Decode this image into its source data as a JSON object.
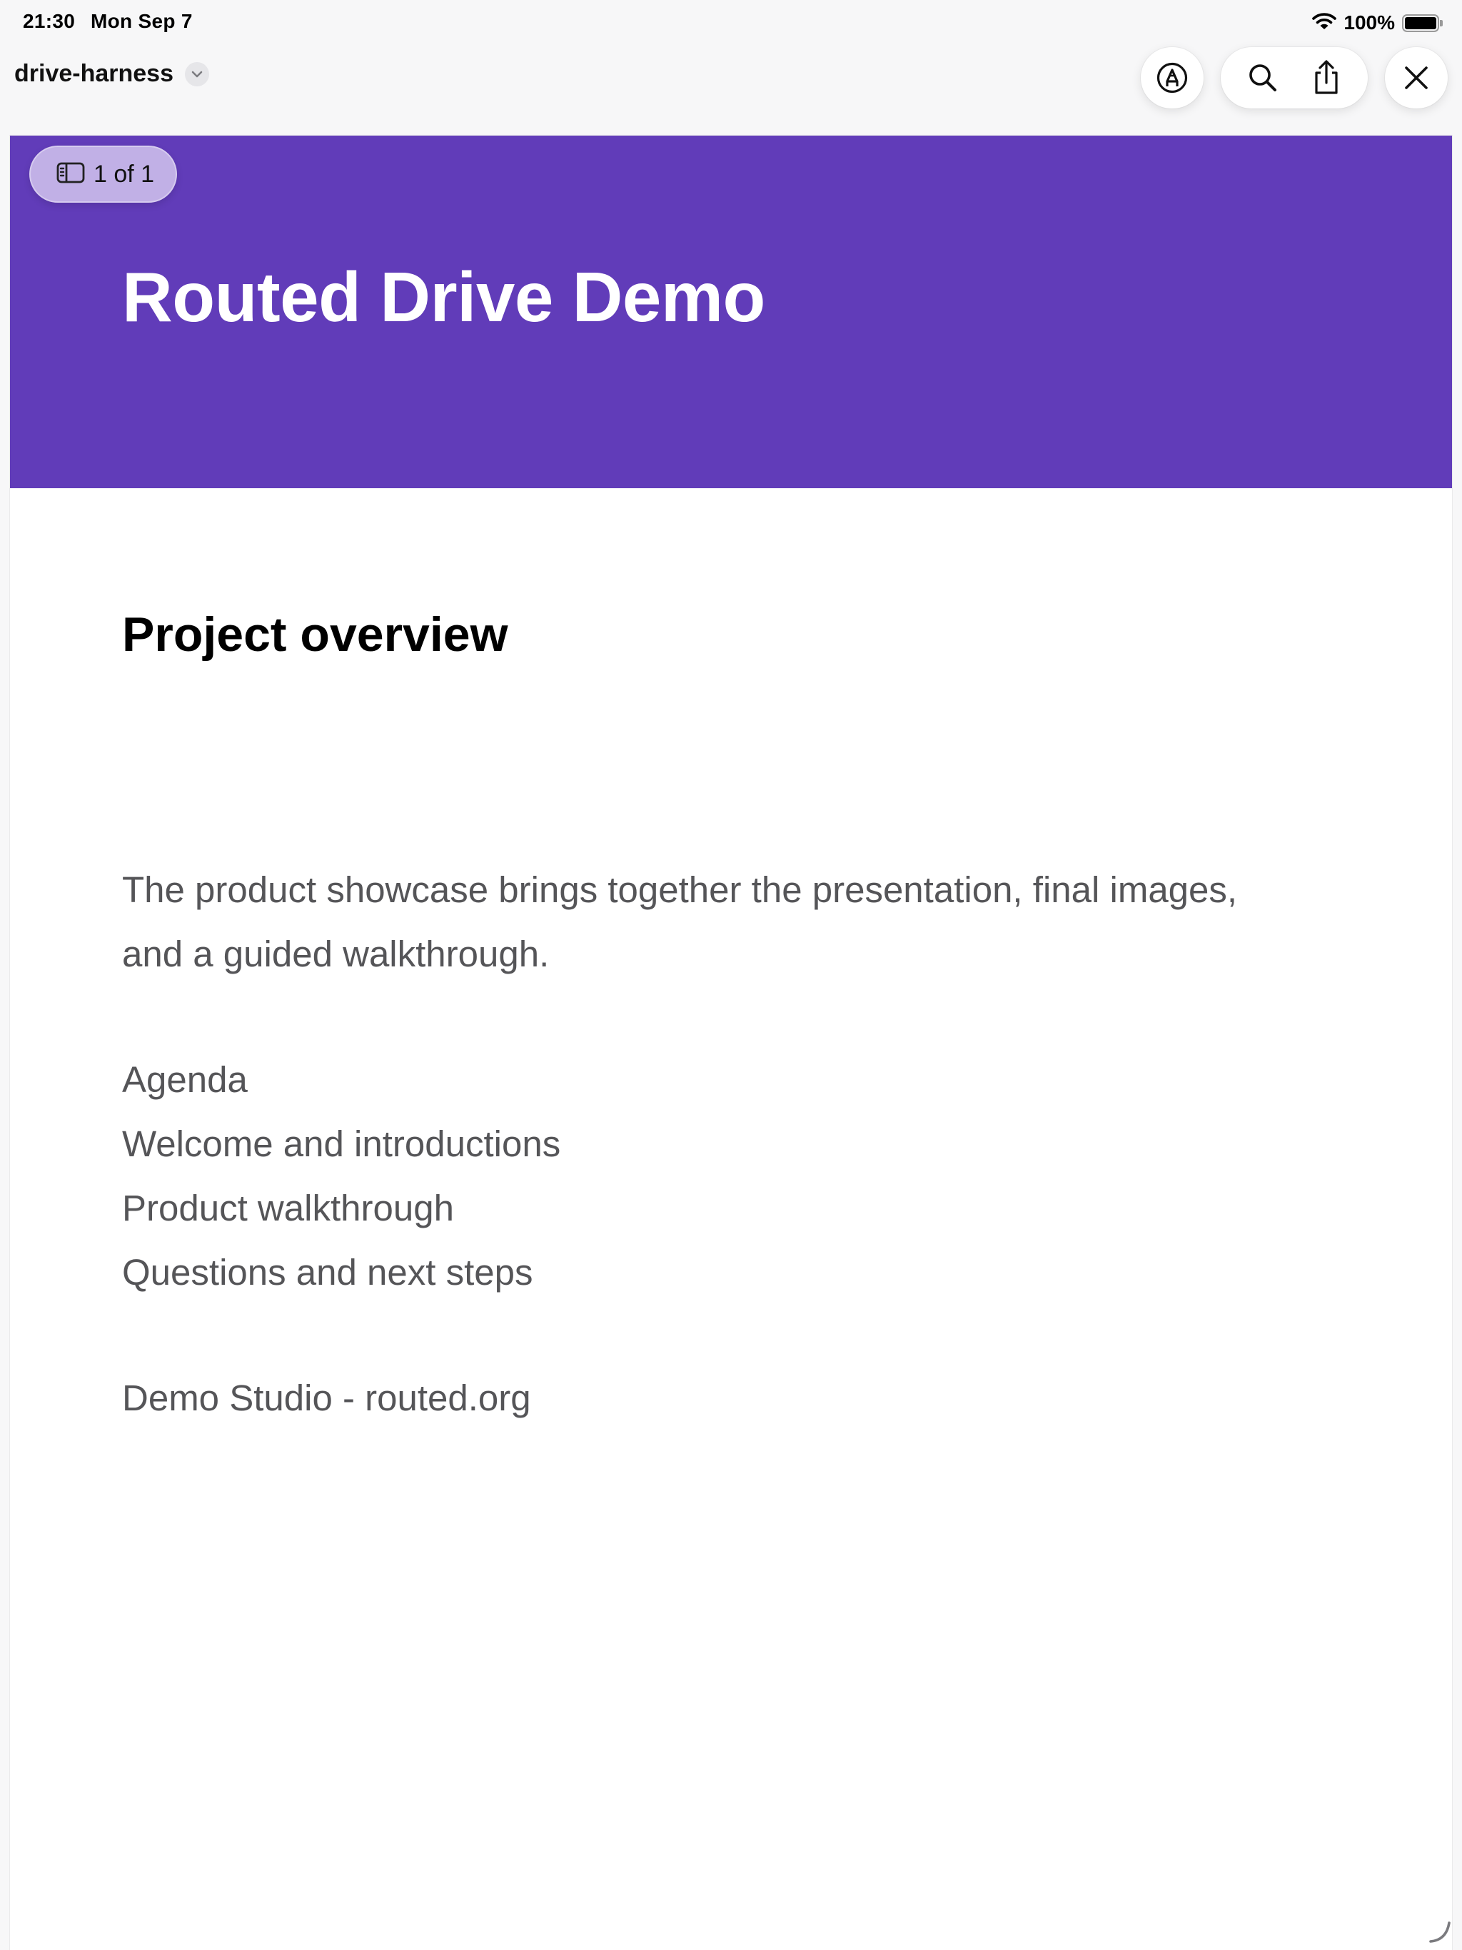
{
  "status_bar": {
    "time": "21:30",
    "date": "Mon Sep 7",
    "battery_percent": "100%",
    "battery_level": 1.0,
    "icons": [
      "wifi-icon",
      "battery-icon"
    ]
  },
  "nav": {
    "title": "drive-harness",
    "chevron_icon": "chevron-down-icon",
    "actions": [
      {
        "icon": "markup-pen-icon"
      },
      {
        "icon": "search-icon"
      },
      {
        "icon": "share-icon"
      },
      {
        "icon": "close-icon"
      }
    ]
  },
  "document": {
    "page_indicator": "1 of 1",
    "page_indicator_icon": "sidebar-icon",
    "header_color": "#613cb9",
    "title": "Routed Drive Demo",
    "section_heading": "Project overview",
    "body_line_1": "The product showcase brings together the presentation, final images,",
    "body_line_2": "and a guided walkthrough.",
    "agenda": [
      "Agenda",
      "Welcome and introductions",
      "Product walkthrough",
      "Questions and next steps"
    ],
    "footer": "Demo Studio - routed.org"
  }
}
